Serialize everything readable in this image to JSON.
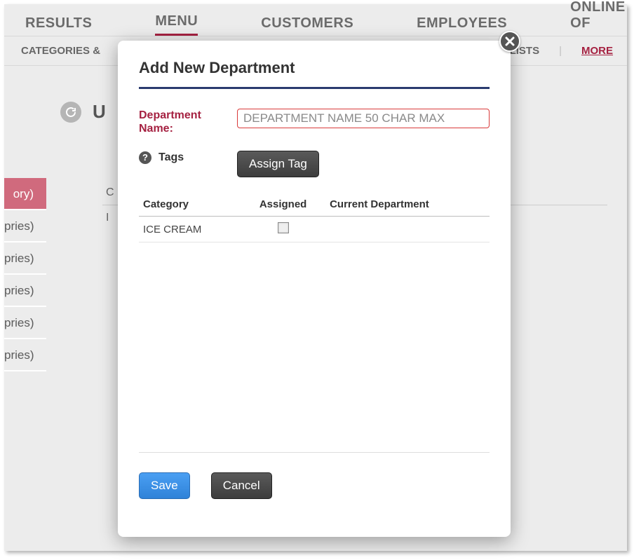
{
  "topTabs": {
    "results": "RESULTS",
    "menu": "MENU",
    "customers": "CUSTOMERS",
    "employees": "EMPLOYEES",
    "online": "ONLINE OF"
  },
  "subTabs": {
    "categories": "CATEGORIES &",
    "icelists": "ICE LISTS",
    "more": "MORE"
  },
  "bg": {
    "header": "U",
    "sidebar": {
      "active": "ory)",
      "items": [
        "pries)",
        "pries)",
        "pries)",
        "pries)",
        "pries)"
      ]
    },
    "midC": "C",
    "midI": "I"
  },
  "modal": {
    "title": "Add New Department",
    "deptLabel": "Department\nName:",
    "deptPlaceholder": "DEPARTMENT NAME 50 CHAR MAX",
    "tagsLabel": "Tags",
    "assignTagBtn": "Assign Tag",
    "table": {
      "colCategory": "Category",
      "colAssigned": "Assigned",
      "colCurrent": "Current Department",
      "rows": [
        {
          "category": "ICE CREAM",
          "assigned": false,
          "current": ""
        }
      ]
    },
    "saveBtn": "Save",
    "cancelBtn": "Cancel"
  }
}
